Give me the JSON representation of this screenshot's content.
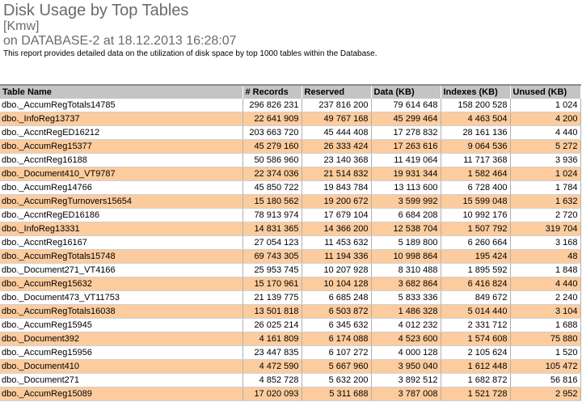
{
  "report": {
    "title": "Disk Usage by Top Tables",
    "subtitle1": "[Kmw]",
    "subtitle2": "on DATABASE-2 at 18.12.2013 16:28:07",
    "description": "This report provides detailed data on the utilization of disk space by top 1000 tables within the Database."
  },
  "colors": {
    "header_bg": "#c4c4c4",
    "alt_row_bg": "#fccc9e",
    "title_color": "#6b6b6b"
  },
  "table": {
    "columns": [
      "Table Name",
      "# Records",
      "Reserved",
      "Data (KB)",
      "Indexes (KB)",
      "Unused (KB)"
    ],
    "rows": [
      [
        "dbo._AccumRegTotals14785",
        "296 826 231",
        "237 816 200",
        "79 614 648",
        "158 200 528",
        "1 024"
      ],
      [
        "dbo._InfoReg13737",
        "22 641 909",
        "49 767 168",
        "45 299 464",
        "4 463 504",
        "4 200"
      ],
      [
        "dbo._AccntRegED16212",
        "203 663 720",
        "45 444 408",
        "17 278 832",
        "28 161 136",
        "4 440"
      ],
      [
        "dbo._AccumReg15377",
        "45 279 160",
        "26 333 424",
        "17 263 616",
        "9 064 536",
        "5 272"
      ],
      [
        "dbo._AccntReg16188",
        "50 586 960",
        "23 140 368",
        "11 419 064",
        "11 717 368",
        "3 936"
      ],
      [
        "dbo._Document410_VT9787",
        "22 374 036",
        "21 514 832",
        "19 931 344",
        "1 582 464",
        "1 024"
      ],
      [
        "dbo._AccumReg14766",
        "45 850 722",
        "19 843 784",
        "13 113 600",
        "6 728 400",
        "1 784"
      ],
      [
        "dbo._AccumRegTurnovers15654",
        "15 180 562",
        "19 200 672",
        "3 599 992",
        "15 599 048",
        "1 632"
      ],
      [
        "dbo._AccntRegED16186",
        "78 913 974",
        "17 679 104",
        "6 684 208",
        "10 992 176",
        "2 720"
      ],
      [
        "dbo._InfoReg13331",
        "14 831 365",
        "14 366 200",
        "12 538 704",
        "1 507 792",
        "319 704"
      ],
      [
        "dbo._AccntReg16167",
        "27 054 123",
        "11 453 632",
        "5 189 800",
        "6 260 664",
        "3 168"
      ],
      [
        "dbo._AccumRegTotals15748",
        "69 743 305",
        "11 194 336",
        "10 998 864",
        "195 424",
        "48"
      ],
      [
        "dbo._Document271_VT4166",
        "25 953 745",
        "10 207 928",
        "8 310 488",
        "1 895 592",
        "1 848"
      ],
      [
        "dbo._AccumReg15632",
        "15 170 961",
        "10 104 128",
        "3 682 864",
        "6 416 824",
        "4 440"
      ],
      [
        "dbo._Document473_VT11753",
        "21 139 775",
        "6 685 248",
        "5 833 336",
        "849 672",
        "2 240"
      ],
      [
        "dbo._AccumRegTotals16038",
        "13 501 818",
        "6 503 872",
        "1 486 328",
        "5 014 440",
        "3 104"
      ],
      [
        "dbo._AccumReg15945",
        "26 025 214",
        "6 345 632",
        "4 012 232",
        "2 331 712",
        "1 688"
      ],
      [
        "dbo._Document392",
        "4 161 809",
        "6 174 088",
        "4 523 600",
        "1 574 608",
        "75 880"
      ],
      [
        "dbo._AccumReg15956",
        "23 447 835",
        "6 107 272",
        "4 000 128",
        "2 105 624",
        "1 520"
      ],
      [
        "dbo._Document410",
        "4 472 590",
        "5 667 960",
        "3 950 040",
        "1 612 448",
        "105 472"
      ],
      [
        "dbo._Document271",
        "4 852 728",
        "5 632 200",
        "3 892 512",
        "1 682 872",
        "56 816"
      ],
      [
        "dbo._AccumReg15089",
        "17 020 093",
        "5 311 688",
        "3 787 008",
        "1 521 728",
        "2 952"
      ]
    ]
  }
}
